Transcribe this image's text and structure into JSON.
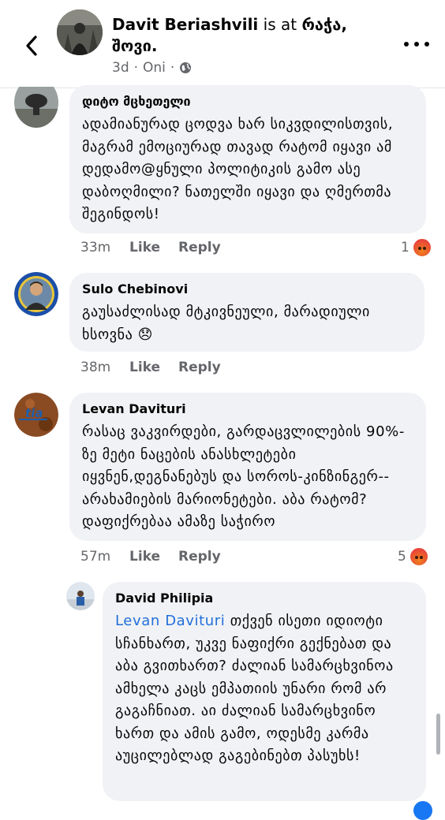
{
  "header": {
    "author": "Davit Beriashvili",
    "is_at": "is at",
    "place": "რაჭა, შოვი.",
    "time": "3d",
    "location_tag": "Oni",
    "icons": {
      "back": "chevron-left-icon",
      "privacy": "globe-icon",
      "more": "more-horizontal-icon"
    }
  },
  "comments": [
    {
      "author": "დიტო მცხეთელი",
      "text": "ადამიანურად ცოდვა ხარ სიკვდილისთვის, მაგრამ ემოციურად თავად რატომ იყავი ამ დედამო@ყნული პოლიტიკის გამო ასე დაბოღმილი? ნათელში იყავი და ღმერთმა შეგინდოს!",
      "time": "33m",
      "like": "Like",
      "reply": "Reply",
      "reaction_count": "1",
      "reaction": "angry"
    },
    {
      "author": "Sulo Chebinovi",
      "text": "გაუსაძლისად მტკივნეული, მარადიული ხსოვნა 😞",
      "time": "38m",
      "like": "Like",
      "reply": "Reply"
    },
    {
      "author": "Levan Davituri",
      "text": "რასაც ვაკვირდები, გარდაცვლილების 90%-ზე მეტი ნაცების ანასხლეტები იყვნენ,დეგნანებუს და სოროს-კინზინგერ--არახამიების მარიონეტები. აბა რატომ?  დაფიქრებაა ამაზე საჭირო",
      "time": "57m",
      "like": "Like",
      "reply": "Reply",
      "reaction_count": "5",
      "reaction": "angry"
    }
  ],
  "reply": {
    "author": "David Philipia",
    "mention": "Levan Daviturі",
    "text": " თქვენ ისეთი იდიოტი სჩანხართ, უკვე ნაფიქრი გექნებათ და აბა გვითხართ? ძალიან სამარცხვინოა ამხელა კაცს ემპათიის უნარი რომ არ გაგაჩნიათ. აი ძალიან სამარცხვინო ხართ და ამის გამო, ოდესმე კარმა აუცილებლად გაგებინებთ პასუხს!"
  },
  "colors": {
    "bubble": "#f0f2f5",
    "meta": "#65676b",
    "link": "#216fdb",
    "angry": "#e8463a"
  }
}
